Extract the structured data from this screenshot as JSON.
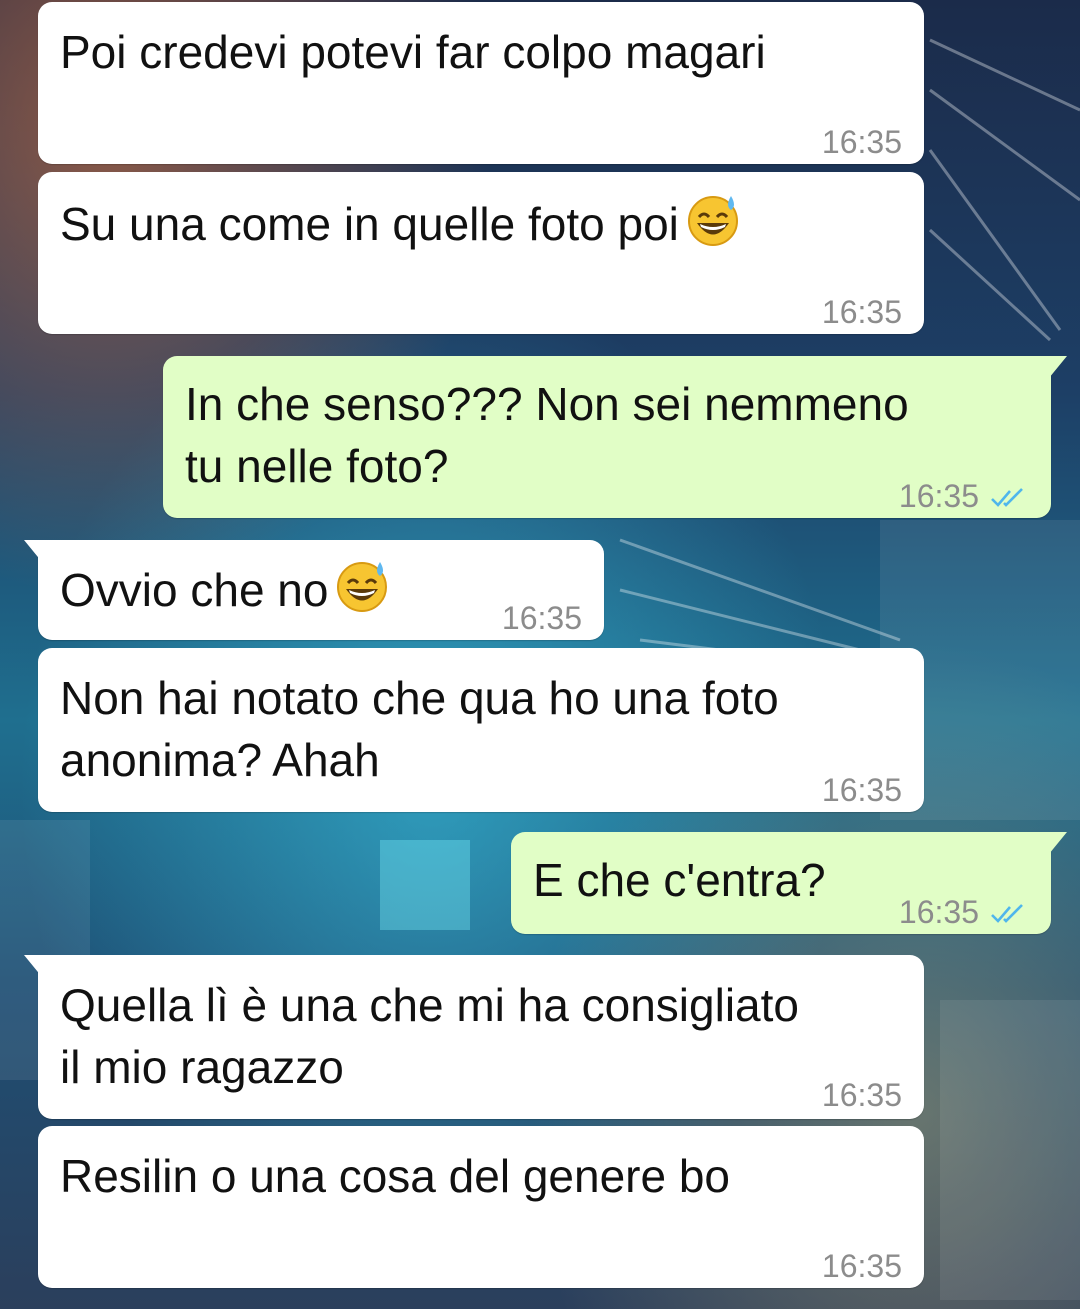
{
  "colors": {
    "incoming_bubble": "#ffffff",
    "outgoing_bubble": "#e1fec6",
    "timestamp": "#8c8c8c",
    "read_ticks": "#4fb6ec"
  },
  "messages": [
    {
      "direction": "in",
      "text": "Poi credevi potevi far colpo magari",
      "time": "16:35"
    },
    {
      "direction": "in",
      "text": "Su una come in quelle foto poi",
      "emoji": "grinning-face-with-sweat-icon",
      "time": "16:35"
    },
    {
      "direction": "out",
      "line1": "In che senso??? Non sei nemmeno",
      "line2": "tu nelle foto?",
      "time": "16:35",
      "status": "read-double-check-icon"
    },
    {
      "direction": "in",
      "text": "Ovvio che no",
      "emoji": "grinning-face-with-sweat-icon",
      "time": "16:35"
    },
    {
      "direction": "in",
      "line1": "Non hai notato che qua ho una foto",
      "line2": "anonima? Ahah",
      "time": "16:35"
    },
    {
      "direction": "out",
      "text": "E che c'entra?",
      "time": "16:35",
      "status": "read-double-check-icon"
    },
    {
      "direction": "in",
      "line1": "Quella lì è una che mi ha consigliato",
      "line2": "il mio ragazzo",
      "time": "16:35"
    },
    {
      "direction": "in",
      "text": "Resilin o una cosa del genere bo",
      "time": "16:35"
    }
  ]
}
